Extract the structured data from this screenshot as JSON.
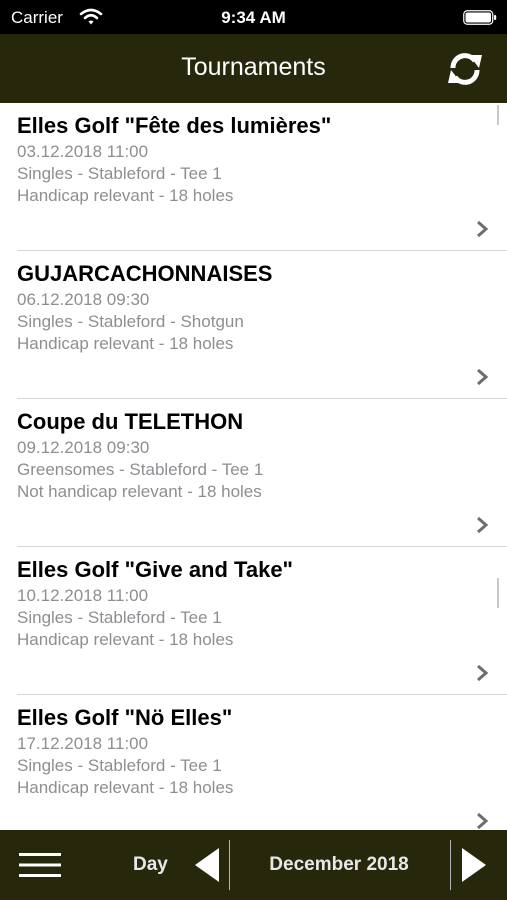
{
  "status": {
    "carrier": "Carrier",
    "time": "9:34 AM"
  },
  "header": {
    "title": "Tournaments",
    "refresh_icon": "refresh-icon"
  },
  "tournaments": [
    {
      "title": "Elles Golf \"Fête des lumières\"",
      "datetime": "03.12.2018 11:00",
      "format": "Singles - Stableford - Tee 1",
      "handicap": "Handicap relevant - 18 holes"
    },
    {
      "title": "GUJARCACHONNAISES",
      "datetime": "06.12.2018 09:30",
      "format": "Singles - Stableford - Shotgun",
      "handicap": "Handicap relevant - 18 holes"
    },
    {
      "title": "Coupe du TELETHON",
      "datetime": "09.12.2018 09:30",
      "format": "Greensomes - Stableford - Tee 1",
      "handicap": "Not handicap relevant - 18 holes"
    },
    {
      "title": "Elles Golf \"Give and Take\"",
      "datetime": "10.12.2018 11:00",
      "format": "Singles - Stableford - Tee 1",
      "handicap": "Handicap relevant - 18 holes"
    },
    {
      "title": "Elles Golf \"Nö Elles\"",
      "datetime": "17.12.2018 11:00",
      "format": "Singles - Stableford - Tee 1",
      "handicap": "Handicap relevant - 18 holes"
    }
  ],
  "toolbar": {
    "view_mode": "Day",
    "month": "December 2018"
  },
  "colors": {
    "bar_background": "#27280b",
    "secondary_text": "#8e8e93"
  }
}
